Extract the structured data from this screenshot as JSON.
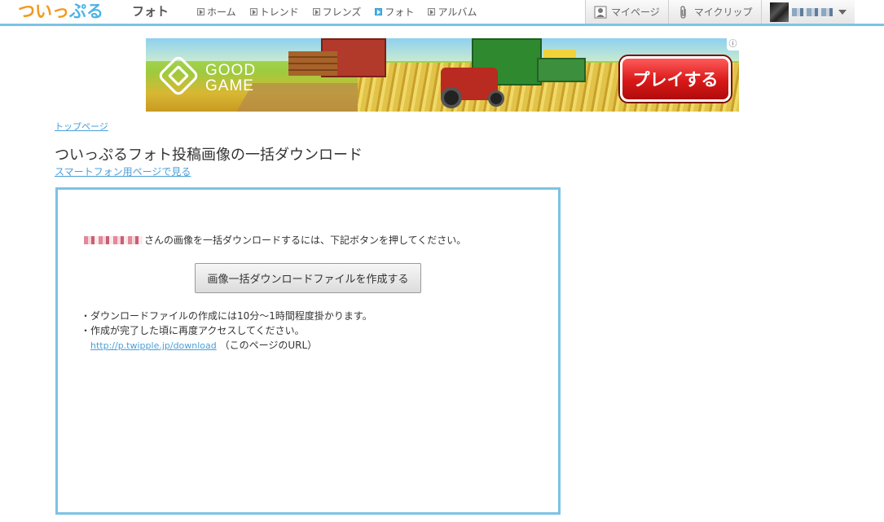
{
  "header": {
    "logo_part1": "ついっ",
    "logo_part2": "ぷる",
    "section_title": "フォト",
    "nav": [
      {
        "label": "ホーム"
      },
      {
        "label": "トレンド"
      },
      {
        "label": "フレンズ"
      },
      {
        "label": "フォト"
      },
      {
        "label": "アルバム"
      }
    ],
    "mypage_label": "マイページ",
    "myclip_label": "マイクリップ"
  },
  "ad": {
    "brand_line1": "GOOD",
    "brand_line2": "GAME",
    "play_label": "プレイする",
    "info_glyph": "ⓘ"
  },
  "breadcrumb": "トップページ",
  "page_title": "ついっぷるフォト投稿画像の一括ダウンロード",
  "smartphone_link": "スマートフォン用ページで見る",
  "panel": {
    "intro_text": "さんの画像を一括ダウンロードするには、下記ボタンを押してください。",
    "create_button": "画像一括ダウンロードファイルを作成する",
    "note1": "・ダウンロードファイルの作成には10分〜1時間程度掛かります。",
    "note2": "・作成が完了した頃に再度アクセスしてください。",
    "download_url": "http://p.twipple.jp/download",
    "url_suffix": "（このページのURL）"
  },
  "colors": {
    "accent": "#7cc3e6",
    "link": "#4a9fd8",
    "logo_orange": "#f39a1e",
    "logo_blue": "#4bb4e6"
  }
}
